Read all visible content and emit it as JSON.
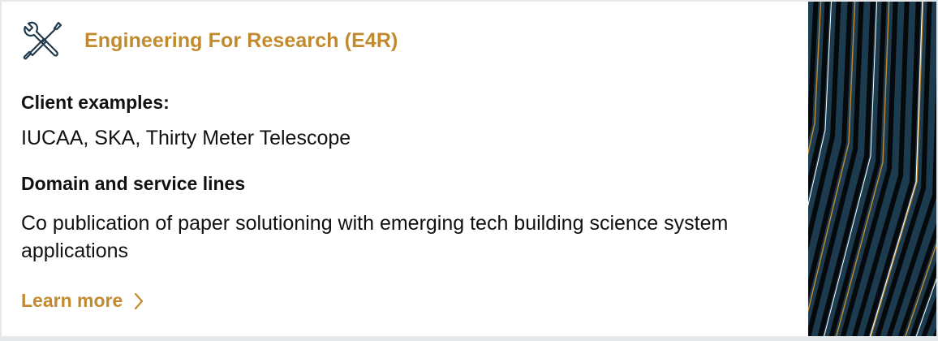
{
  "card": {
    "title": "Engineering For Research (E4R)",
    "icon": "wrench-screwdriver-icon",
    "client_heading": "Client examples:",
    "client_value": "IUCAA, SKA, Thirty Meter Telescope",
    "domain_heading": "Domain and service lines",
    "domain_value": "Co publication of paper solutioning with emerging tech building science system applications",
    "learn_more_label": "Learn more",
    "learn_more_icon": "chevron-right-icon"
  },
  "colors": {
    "accent": "#c28a2e",
    "text": "#111111",
    "art_background": "#1d3b4f",
    "page_background": "#e6e9ec"
  }
}
